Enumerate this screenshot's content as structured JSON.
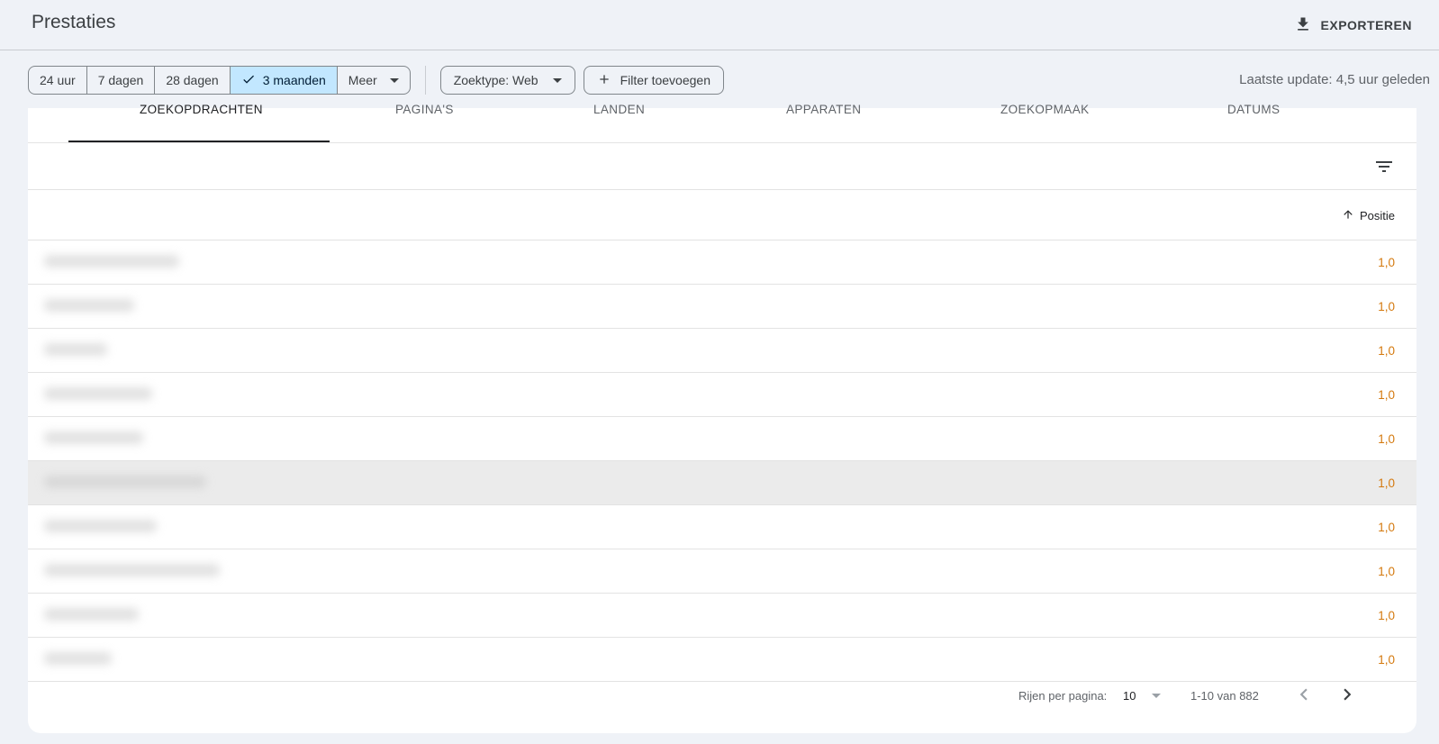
{
  "header": {
    "title": "Prestaties",
    "export_label": "EXPORTEREN"
  },
  "date_range": {
    "options": [
      {
        "label": "24 uur",
        "selected": false
      },
      {
        "label": "7 dagen",
        "selected": false
      },
      {
        "label": "28 dagen",
        "selected": false
      },
      {
        "label": "3 maanden",
        "selected": true
      },
      {
        "label": "Meer",
        "selected": false
      }
    ]
  },
  "search_type": {
    "label": "Zoektype: Web"
  },
  "add_filter": {
    "label": "Filter toevoegen"
  },
  "last_update": "Laatste update: 4,5 uur geleden",
  "tabs": [
    {
      "label": "ZOEKOPDRACHTEN",
      "active": true
    },
    {
      "label": "PAGINA'S",
      "active": false
    },
    {
      "label": "LANDEN",
      "active": false
    },
    {
      "label": "APPARATEN",
      "active": false
    },
    {
      "label": "ZOEKOPMAAK",
      "active": false
    },
    {
      "label": "DATUMS",
      "active": false
    }
  ],
  "table": {
    "sort_column": "Positie",
    "rows": [
      {
        "position": "1,0"
      },
      {
        "position": "1,0"
      },
      {
        "position": "1,0"
      },
      {
        "position": "1,0"
      },
      {
        "position": "1,0"
      },
      {
        "position": "1,0",
        "highlighted": true
      },
      {
        "position": "1,0"
      },
      {
        "position": "1,0"
      },
      {
        "position": "1,0"
      },
      {
        "position": "1,0"
      }
    ]
  },
  "pagination": {
    "rows_per_page_label": "Rijen per pagina:",
    "rows_per_page": "10",
    "range": "1-10 van 882"
  },
  "colors": {
    "accent_selected": "#c2e7ff",
    "position_value": "#d4790e"
  }
}
